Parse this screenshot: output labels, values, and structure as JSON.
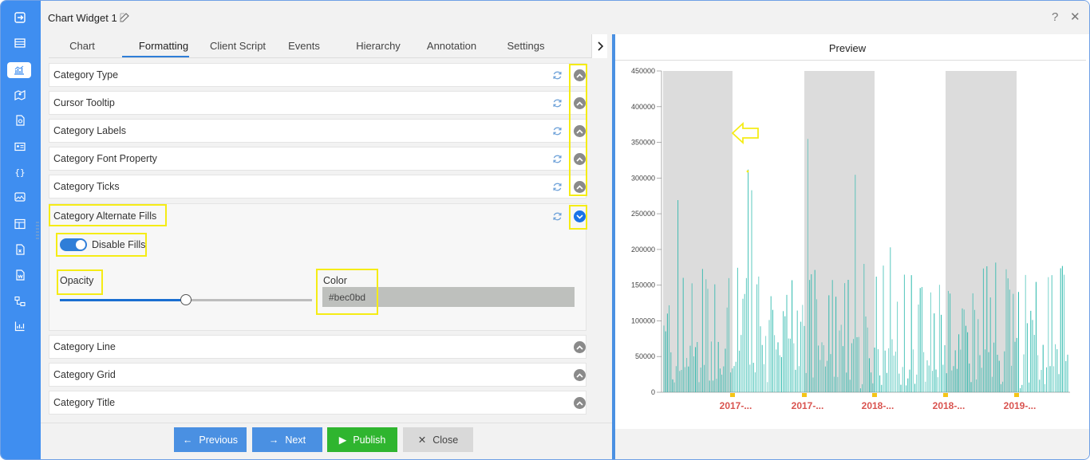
{
  "window": {
    "title": "Chart Widget 1",
    "help_label": "?",
    "close_label": "✕"
  },
  "tabs": [
    {
      "label": "Chart"
    },
    {
      "label": "Formatting"
    },
    {
      "label": "Client Script"
    },
    {
      "label": "Events"
    },
    {
      "label": "Hierarchy"
    },
    {
      "label": "Annotation"
    },
    {
      "label": "Settings"
    }
  ],
  "active_tab": "Formatting",
  "sections": [
    {
      "label": "Category Type"
    },
    {
      "label": "Cursor Tooltip"
    },
    {
      "label": "Category Labels"
    },
    {
      "label": "Category Font Property"
    },
    {
      "label": "Category Ticks"
    },
    {
      "label": "Category Alternate Fills"
    },
    {
      "label": "Category Line"
    },
    {
      "label": "Category Grid"
    },
    {
      "label": "Category Title"
    }
  ],
  "alternate_fills": {
    "toggle_label": "Disable Fills",
    "toggle_on": true,
    "opacity_label": "Opacity",
    "opacity_value": 0.5,
    "color_label": "Color",
    "color_value": "#bec0bd"
  },
  "footer": {
    "previous": "Previous",
    "next": "Next",
    "publish": "Publish",
    "close": "Close"
  },
  "preview": {
    "title": "Preview"
  },
  "colors": {
    "sidebar": "#3f8ef0",
    "accent": "#2f7ed8",
    "publish": "#2fb52f",
    "highlight": "#f5ec15",
    "series": "#1fb5a8",
    "fill_band": "#dcdcdc",
    "x_label": "#d9534f"
  },
  "chart_data": {
    "type": "bar",
    "y_ticks": [
      "0",
      "50000",
      "100000",
      "150000",
      "200000",
      "250000",
      "300000",
      "350000",
      "400000",
      "450000"
    ],
    "ylim": [
      0,
      450000
    ],
    "x_labels": [
      "2017-...",
      "2017-...",
      "2018-...",
      "2018-...",
      "2019-..."
    ],
    "alternate_fills": true,
    "series_color": "#1fb5a8"
  }
}
